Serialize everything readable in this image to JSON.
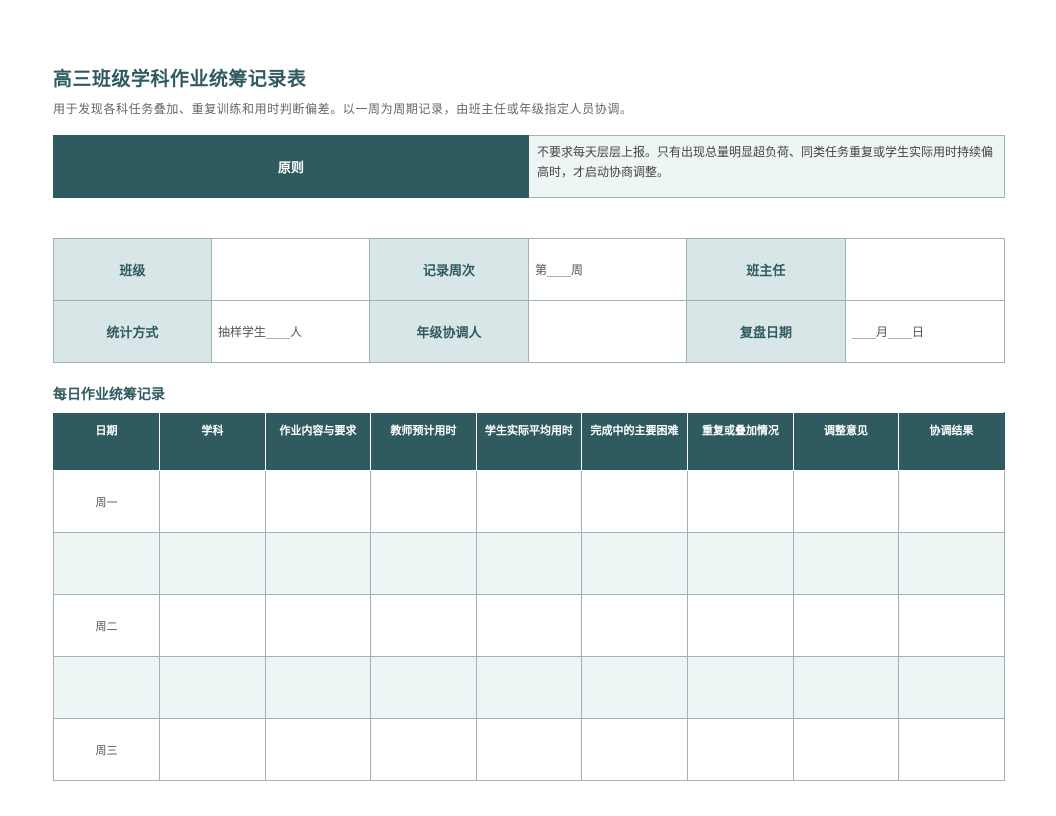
{
  "title": "高三班级学科作业统筹记录表",
  "subtitle": "用于发现各科任务叠加、重复训练和用时判断偏差。以一周为周期记录，由班主任或年级指定人员协调。",
  "principle": {
    "label": "原则",
    "text": "不要求每天层层上报。只有出现总量明显超负荷、同类任务重复或学生实际用时持续偏高时，才启动协商调整。"
  },
  "info": {
    "class_label": "班级",
    "class_value": "",
    "week_label": "记录周次",
    "week_value": "第____周",
    "teacher_label": "班主任",
    "teacher_value": "",
    "method_label": "统计方式",
    "method_value": "抽样学生____人",
    "coordinator_label": "年级协调人",
    "coordinator_value": "",
    "review_label": "复盘日期",
    "review_value": "____月____日"
  },
  "log": {
    "section_title": "每日作业统筹记录",
    "headers": [
      "日期",
      "学科",
      "作业内容与要求",
      "教师预计用时",
      "学生实际平均用时",
      "完成中的主要困难",
      "重复或叠加情况",
      "调整意见",
      "协调结果"
    ],
    "days": [
      "周一",
      "",
      "周二",
      "",
      "周三"
    ]
  }
}
